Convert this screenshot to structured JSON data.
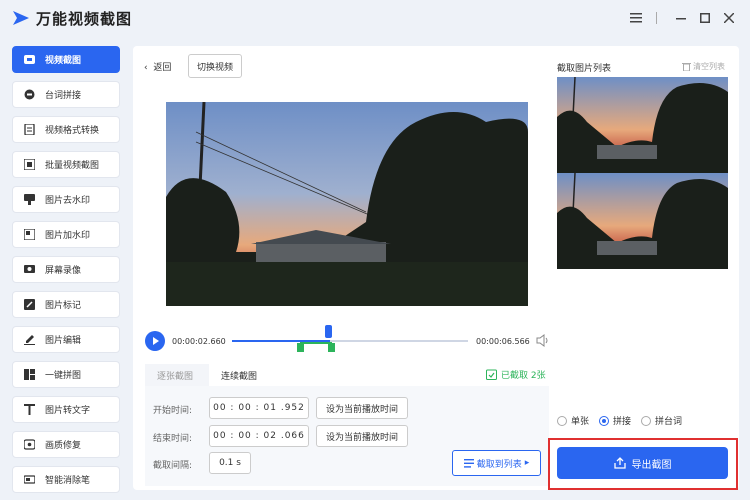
{
  "app": {
    "title": "万能视频截图"
  },
  "sidebar": {
    "items": [
      {
        "label": "视频截图",
        "icon": "video-capture-icon",
        "active": true
      },
      {
        "label": "台词拼接",
        "icon": "subtitle-join-icon"
      },
      {
        "label": "视频格式转换",
        "icon": "format-convert-icon"
      },
      {
        "label": "批量视频截图",
        "icon": "batch-capture-icon"
      },
      {
        "label": "图片去水印",
        "icon": "remove-watermark-icon"
      },
      {
        "label": "图片加水印",
        "icon": "add-watermark-icon"
      },
      {
        "label": "屏幕录像",
        "icon": "screen-record-icon"
      },
      {
        "label": "图片标记",
        "icon": "image-mark-icon"
      },
      {
        "label": "图片编辑",
        "icon": "image-edit-icon"
      },
      {
        "label": "一键拼图",
        "icon": "collage-icon"
      },
      {
        "label": "图片转文字",
        "icon": "ocr-icon"
      },
      {
        "label": "画质修复",
        "icon": "quality-repair-icon"
      },
      {
        "label": "智能消除笔",
        "icon": "erase-pen-icon"
      }
    ]
  },
  "toolbar": {
    "back_label": "返回",
    "switch_label": "切换视频"
  },
  "player": {
    "current_time": "00:00:02.660",
    "total_time": "00:00:06.566",
    "progress": 0.41
  },
  "tabs": {
    "single": "逐张截图",
    "continuous": "连续截图"
  },
  "status": {
    "captured": "已截取 2张"
  },
  "form": {
    "start_label": "开始时间:",
    "start_value": "00 : 00 : 01 .952",
    "end_label": "结束时间:",
    "end_value": "00 : 00 : 02 .066",
    "interval_label": "截取间隔:",
    "interval_value": "0.1 s",
    "set_current_label": "设为当前播放时间",
    "capture_to_list_label": "截取到列表"
  },
  "list": {
    "title": "截取图片列表",
    "clear_label": "清空列表"
  },
  "options": {
    "single_label": "单张",
    "join_label": "拼接",
    "subtitle_join_label": "拼台词",
    "selected": "拼接"
  },
  "export": {
    "label": "导出截图"
  },
  "colors": {
    "accent": "#2a66f0",
    "success": "#2db45b",
    "highlight": "#e03030"
  }
}
